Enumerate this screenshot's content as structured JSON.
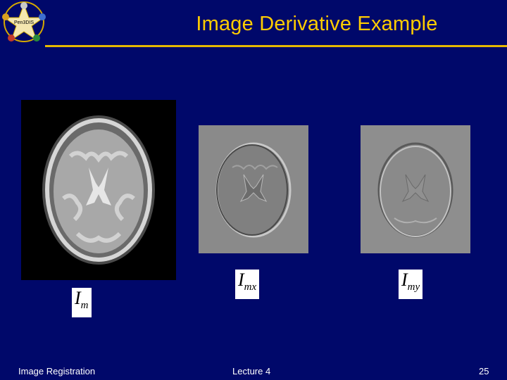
{
  "slide": {
    "title": "Image Derivative Example",
    "logo_text": "Pen3DIS",
    "labels": {
      "im_base": "I",
      "im_sub": "m",
      "imx_base": "I",
      "imx_sub": "mx",
      "imy_base": "I",
      "imy_sub": "my"
    },
    "footer": {
      "left": "Image Registration",
      "center": "Lecture 4",
      "page": "25"
    }
  },
  "colors": {
    "background": "#00086a",
    "title": "#ffcc00",
    "rule": "#e6b800",
    "footer_text": "#ffffff"
  }
}
